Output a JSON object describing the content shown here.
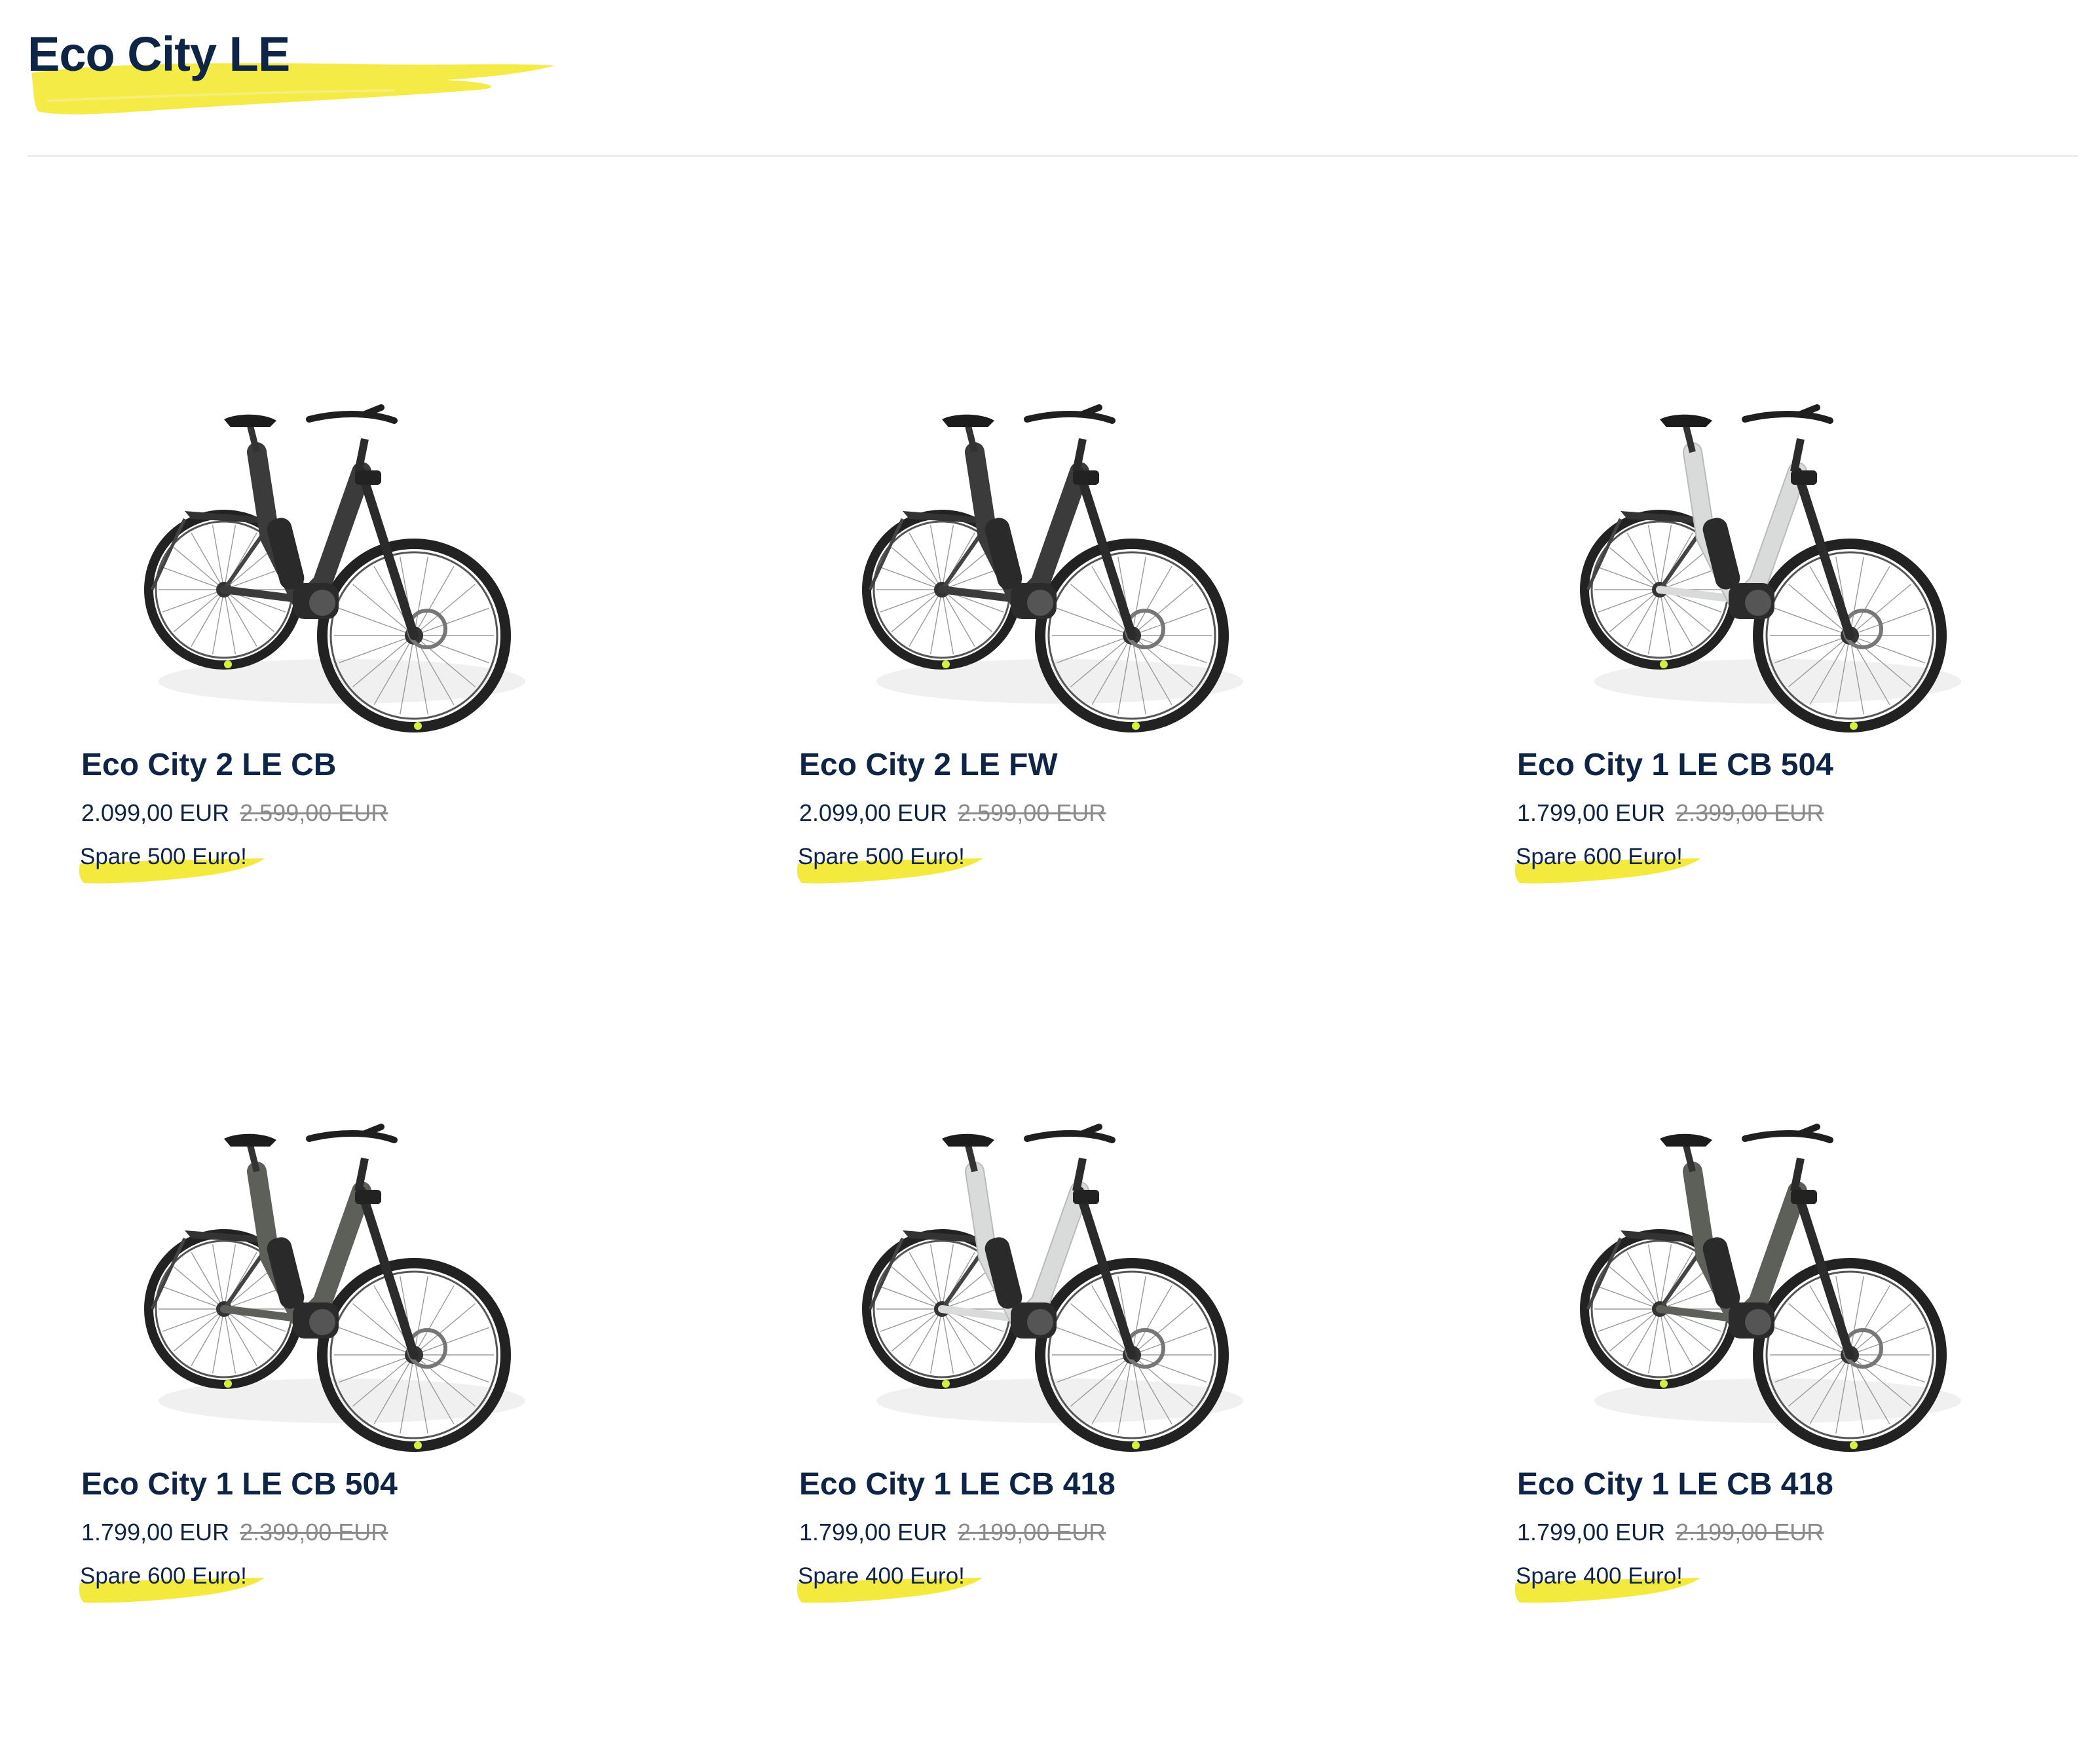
{
  "page": {
    "title": "Eco City LE",
    "accent_color": "#f4ea3d",
    "text_color": "#0f2547"
  },
  "products": [
    {
      "name": "Eco City 2 LE CB",
      "price": "2.099,00 EUR",
      "old_price": "2.599,00 EUR",
      "savings": "Spare 500 Euro!",
      "frame_color": "#3a3b3a",
      "image_icon": "bike-dark-image"
    },
    {
      "name": "Eco City 2 LE FW",
      "price": "2.099,00 EUR",
      "old_price": "2.599,00 EUR",
      "savings": "Spare 500 Euro!",
      "frame_color": "#3a3b3a",
      "image_icon": "bike-dark-image"
    },
    {
      "name": "Eco City 1 LE CB 504",
      "price": "1.799,00 EUR",
      "old_price": "2.399,00 EUR",
      "savings": "Spare 600 Euro!",
      "frame_color": "#d9dada",
      "image_icon": "bike-white-image"
    },
    {
      "name": "Eco City 1 LE CB 504",
      "price": "1.799,00 EUR",
      "old_price": "2.399,00 EUR",
      "savings": "Spare 600 Euro!",
      "frame_color": "#5c6058",
      "image_icon": "bike-olive-image"
    },
    {
      "name": "Eco City 1 LE CB 418",
      "price": "1.799,00 EUR",
      "old_price": "2.199,00 EUR",
      "savings": "Spare 400 Euro!",
      "frame_color": "#d9dada",
      "image_icon": "bike-white-image"
    },
    {
      "name": "Eco City 1 LE CB 418",
      "price": "1.799,00 EUR",
      "old_price": "2.199,00 EUR",
      "savings": "Spare 400 Euro!",
      "frame_color": "#5c6058",
      "image_icon": "bike-olive-image"
    }
  ]
}
